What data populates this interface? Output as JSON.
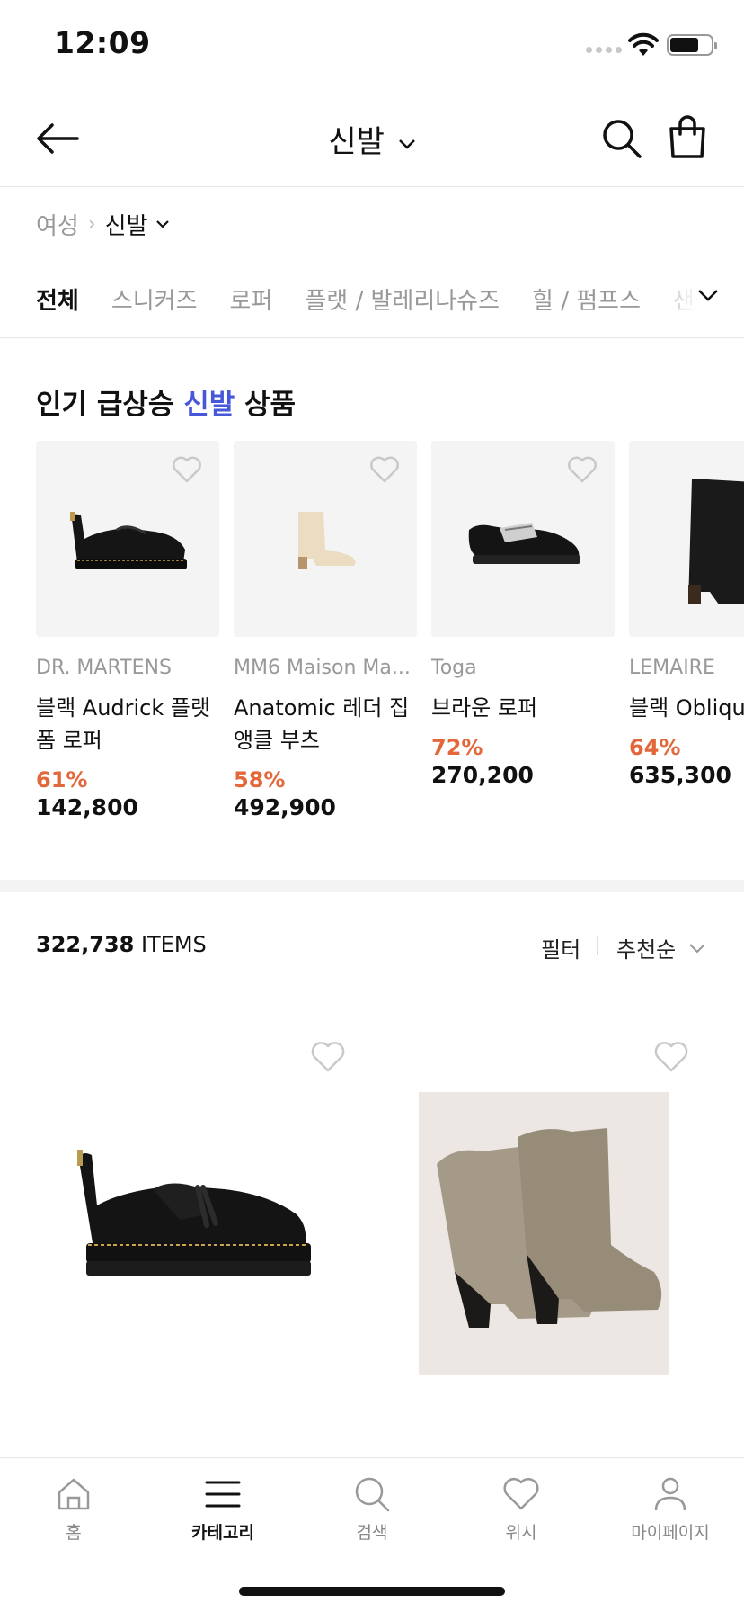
{
  "status_bar": {
    "time": "12:09"
  },
  "top_nav": {
    "title": "신발"
  },
  "breadcrumb": {
    "parent": "여성",
    "separator": "›",
    "current": "신발"
  },
  "tabs": [
    {
      "label": "전체",
      "active": true
    },
    {
      "label": "스니커즈",
      "active": false
    },
    {
      "label": "로퍼",
      "active": false
    },
    {
      "label": "플랫 / 발레리나슈즈",
      "active": false
    },
    {
      "label": "힐 / 펌프스",
      "active": false
    },
    {
      "label": "샌들",
      "active": false
    }
  ],
  "trending": {
    "title_before": "인기 급상승 ",
    "title_highlight": "신발",
    "title_after": " 상품",
    "highlight_color": "#4658d8",
    "products": [
      {
        "brand": "DR. MARTENS",
        "name": "블랙 Audrick 플랫폼 로퍼",
        "discount": "61%",
        "price": "142,800",
        "image_icon": "black-platform-loafer"
      },
      {
        "brand": "MM6 Maison Ma...",
        "name": "Anatomic 레더 집 앵클 부츠",
        "discount": "58%",
        "price": "492,900",
        "image_icon": "beige-ankle-boot"
      },
      {
        "brand": "Toga",
        "name": "브라운 로퍼",
        "discount": "72%",
        "price": "270,200",
        "image_icon": "buckle-slingback-loafer"
      },
      {
        "brand": "LEMAIRE",
        "name": "블랙 Oblique 부츠",
        "discount": "64%",
        "price": "635,300",
        "image_icon": "black-boot"
      }
    ],
    "discount_color": "#e2673b"
  },
  "listing": {
    "count": "322,738",
    "count_suffix": " ITEMS",
    "filter_label": "필터",
    "sort_label": "추천순",
    "products": [
      {
        "image_icon": "black-tassel-loafer"
      },
      {
        "image_icon": "taupe-suede-western-boot"
      }
    ]
  },
  "bottom_nav": [
    {
      "label": "홈",
      "icon": "home-icon",
      "active": false
    },
    {
      "label": "카테고리",
      "icon": "menu-icon",
      "active": true
    },
    {
      "label": "검색",
      "icon": "search-icon",
      "active": false
    },
    {
      "label": "위시",
      "icon": "heart-icon",
      "active": false
    },
    {
      "label": "마이페이지",
      "icon": "user-icon",
      "active": false
    }
  ]
}
